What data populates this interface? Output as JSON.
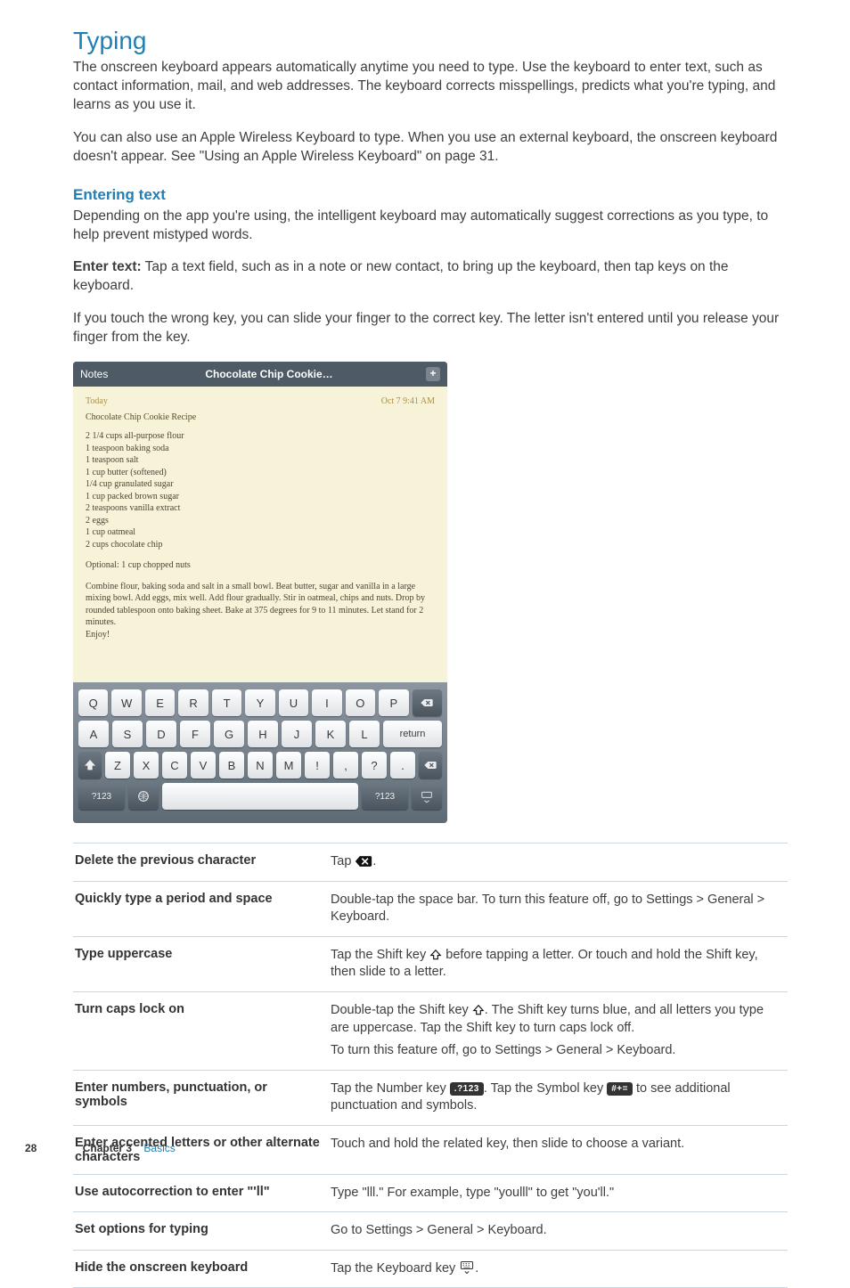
{
  "title": "Typing",
  "intro_p1": "The onscreen keyboard appears automatically anytime you need to type. Use the keyboard to enter text, such as contact information, mail, and web addresses. The keyboard corrects misspellings, predicts what you're typing, and learns as you use it.",
  "intro_p2": "You can also use an Apple Wireless Keyboard to type. When you use an external keyboard, the onscreen keyboard doesn't appear. See \"Using an Apple Wireless Keyboard\" on page 31.",
  "subhead": "Entering text",
  "sub_p1": "Depending on the app you're using, the intelligent keyboard may automatically suggest corrections as you type, to help prevent mistyped words.",
  "sub_p2_label": "Enter text:",
  "sub_p2_body": "  Tap a text field, such as in a note or new contact, to bring up the keyboard, then tap keys on the keyboard.",
  "sub_p3": "If you touch the wrong key, you can slide your finger to the correct key. The letter isn't entered until you release your finger from the key.",
  "device": {
    "app": "Notes",
    "title": "Chocolate Chip Cookie…",
    "plus": "+",
    "meta_left": "Today",
    "meta_right": "Oct 7  9:41 AM",
    "note_title": "Chocolate Chip Cookie Recipe",
    "ingredients": "2 1/4 cups all-purpose flour\n1 teaspoon baking soda\n1 teaspoon salt\n1 cup butter (softened)\n1/4 cup granulated sugar\n1 cup packed brown sugar\n2 teaspoons vanilla extract\n2 eggs\n1 cup oatmeal\n2 cups chocolate chip",
    "optional": "Optional: 1 cup chopped nuts",
    "instructions": "Combine flour, baking soda and salt in a small bowl. Beat butter, sugar and vanilla in a large mixing bowl. Add eggs, mix well. Add flour gradually. Stir in oatmeal, chips and nuts. Drop by rounded tablespoon onto baking sheet. Bake at 375 degrees for 9 to 11 minutes. Let stand for 2 minutes.\nEnjoy!"
  },
  "keys": {
    "row1": [
      "Q",
      "W",
      "E",
      "R",
      "T",
      "Y",
      "U",
      "I",
      "O",
      "P"
    ],
    "row2": [
      "A",
      "S",
      "D",
      "F",
      "G",
      "H",
      "J",
      "K",
      "L"
    ],
    "row3": [
      "Z",
      "X",
      "C",
      "V",
      "B",
      "N",
      "M",
      "!",
      ",",
      "?",
      "."
    ],
    "mode": "?123",
    "return": "return",
    "shift": "⇧",
    "bksp": "⌫",
    "hide": "⌨"
  },
  "table": {
    "rows": [
      {
        "label": "Delete the previous character",
        "desc_pre": "Tap ",
        "icon": "bksp",
        "desc_post": "."
      },
      {
        "label": "Quickly type a period and space",
        "desc": "Double-tap the space bar. To turn this feature off, go to Settings > General > Keyboard."
      },
      {
        "label": "Type uppercase",
        "desc_pre": "Tap the Shift key ",
        "icon": "shift-outline",
        "desc_post": " before tapping a letter. Or touch and hold the Shift key, then slide to a letter."
      },
      {
        "label": "Turn caps lock on",
        "desc_pre": "Double-tap the Shift key ",
        "icon": "shift-outline",
        "desc_post": ". The Shift key turns blue, and all letters you type are uppercase. Tap the Shift key to turn caps lock off.",
        "desc2": "To turn this feature off, go to Settings > General > Keyboard."
      },
      {
        "label": "Enter numbers, punctuation, or symbols",
        "desc_pre": "Tap the Number key ",
        "pill": ".?123",
        "desc_mid": ". Tap the Symbol key ",
        "pill2": "#+=",
        "desc_post": " to see additional punctuation and symbols."
      },
      {
        "label": "Enter accented letters or other alternate characters",
        "desc": "Touch and hold the related key, then slide to choose a variant."
      },
      {
        "label": "Use autocorrection to enter \"'ll\"",
        "desc": "Type \"lll.\" For example, type \"youlll\" to get \"you'll.\""
      },
      {
        "label": "Set options for typing",
        "desc": "Go to Settings > General > Keyboard."
      },
      {
        "label": "Hide the onscreen keyboard",
        "desc_pre": "Tap the Keyboard key ",
        "icon": "kbd-hide",
        "desc_post": "."
      }
    ]
  },
  "footer": {
    "page": "28",
    "chapter": "Chapter 3",
    "name": "Basics"
  }
}
